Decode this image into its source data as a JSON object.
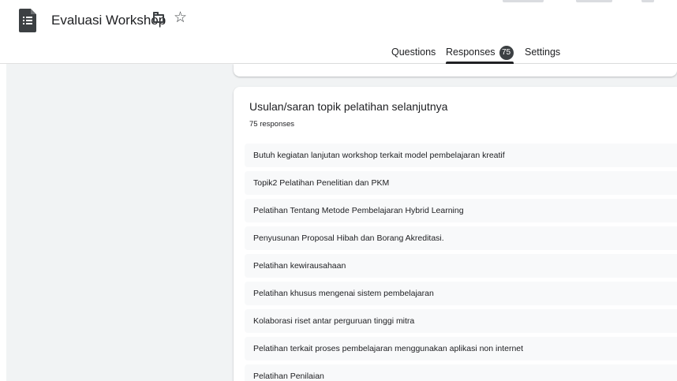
{
  "header": {
    "title": "Evaluasi Workshop",
    "logo_icon": "google-forms-icon",
    "folder_icon": "folder-icon",
    "star_icon": "star-outline-icon"
  },
  "tabs": [
    {
      "label": "Questions"
    },
    {
      "label": "Responses",
      "badge": "75",
      "active": true
    },
    {
      "label": "Settings"
    }
  ],
  "question": {
    "title": "Usulan/saran topik pelatihan selanjutnya",
    "count_label": "75 responses",
    "responses": [
      "Butuh kegiatan lanjutan workshop terkait model pembelajaran kreatif",
      "Topik2 Pelatihan Penelitian dan PKM",
      "Pelatihan Tentang Metode Pembelajaran Hybrid Learning",
      "Penyusunan Proposal Hibah dan Borang Akreditasi.",
      "Pelatihan kewirausahaan",
      "Pelatihan khusus mengenai sistem pembelajaran",
      "Kolaborasi riset antar perguruan tinggi mitra",
      "Pelatihan terkait proses pembelajaran menggunakan aplikasi non internet",
      "Pelatihan Penilaian"
    ]
  },
  "colors": {
    "page_background": "#f1f3f4",
    "card": "#ffffff",
    "response_row": "#f8f9fa",
    "text": "#202124",
    "badge": "#3c4043"
  }
}
